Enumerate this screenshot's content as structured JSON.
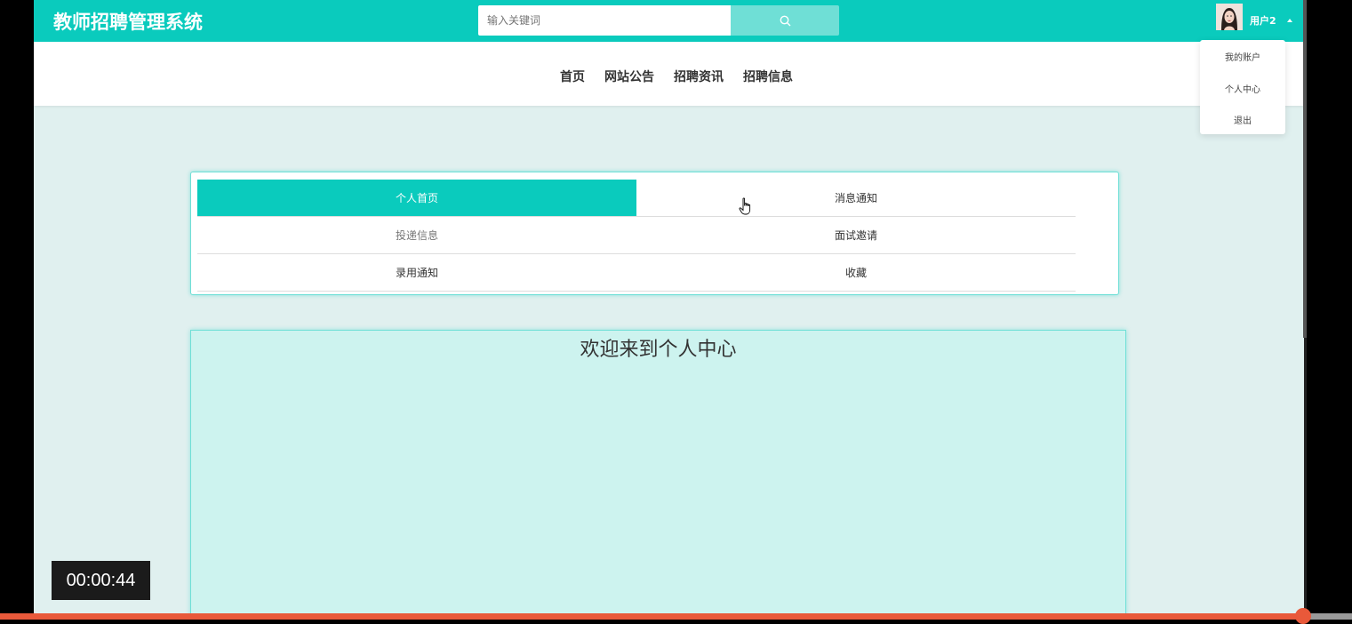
{
  "header": {
    "title": "教师招聘管理系统",
    "search_placeholder": "输入关键词",
    "username": "用户2"
  },
  "nav": {
    "items": [
      "首页",
      "网站公告",
      "招聘资讯",
      "招聘信息"
    ]
  },
  "user_dropdown": {
    "items": [
      "我的账户",
      "个人中心",
      "退出"
    ]
  },
  "menu": {
    "rows": [
      [
        "个人首页",
        "消息通知"
      ],
      [
        "投递信息",
        "面试邀请"
      ],
      [
        "录用通知",
        "收藏"
      ]
    ],
    "active": "个人首页"
  },
  "main": {
    "welcome": "欢迎来到个人中心"
  },
  "video": {
    "time": "00:00:44"
  },
  "colors": {
    "accent": "#0acbbd",
    "search_button": "#6fdfd6",
    "page_bg": "#e0f0ef",
    "content_bg": "#cdf3ef",
    "progress": "#e9593a"
  }
}
